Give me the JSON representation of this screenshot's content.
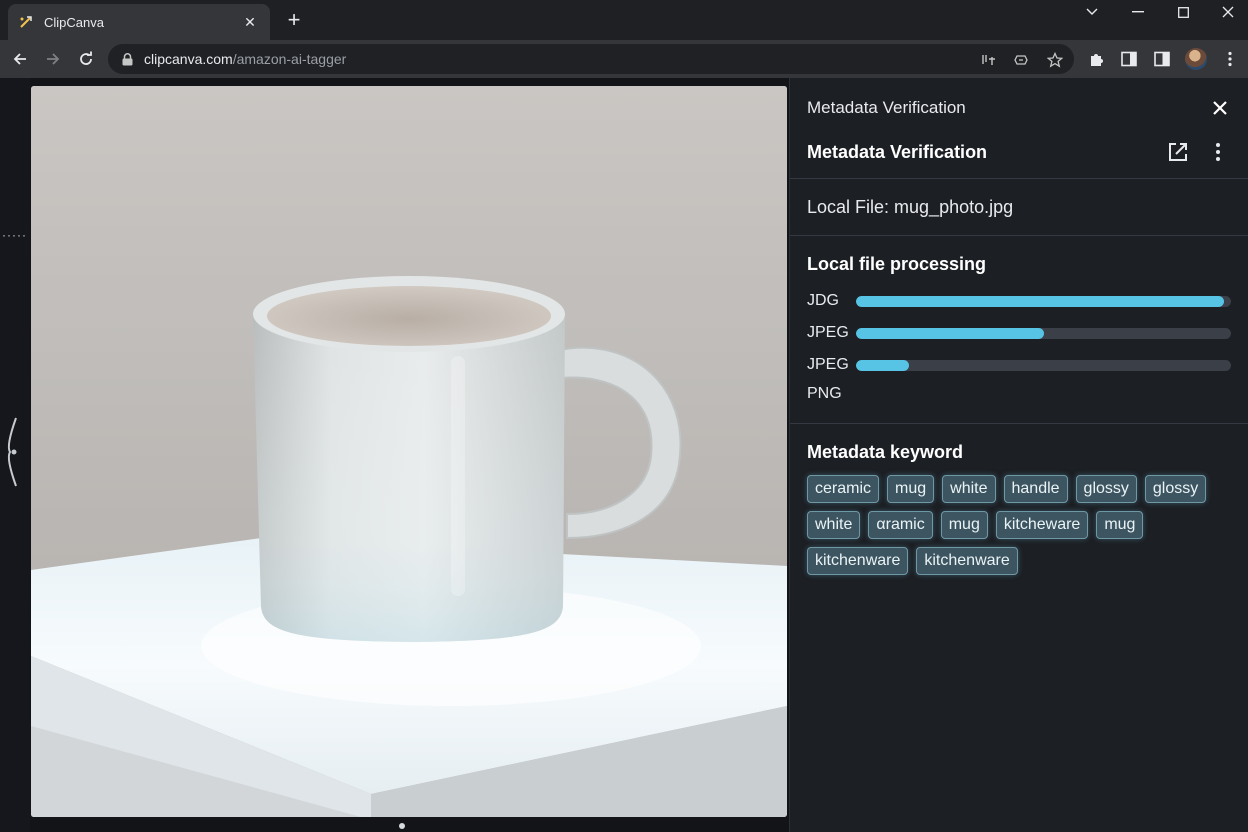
{
  "browser": {
    "tab_title": "ClipCanva",
    "url_host": "clipcanva.com",
    "url_path": "/amazon-ai-tagger"
  },
  "panel": {
    "header_title": "Metadata Verification",
    "sub_title": "Metadata Verification",
    "local_file": "Local File: mug_photo.jpg",
    "processing_title": "Local file processing",
    "processing": [
      {
        "label": "JDG",
        "progress": 0.98
      },
      {
        "label": "JPEG",
        "progress": 0.5
      },
      {
        "label": "JPEG",
        "progress": 0.14
      },
      {
        "label": "PNG",
        "progress": null
      }
    ],
    "keywords_title": "Metadata keyword",
    "keywords": [
      "ceramic",
      "mug",
      "white",
      "handle",
      "glossy",
      "glossy",
      "white",
      "αramic",
      "mug",
      "kitcheware",
      "mug",
      "kitchenware",
      "kitchenware"
    ]
  },
  "colors": {
    "progress_fill": "#57c4e5",
    "chip_bg": "#3d5560",
    "chip_border": "#6f98a6"
  }
}
